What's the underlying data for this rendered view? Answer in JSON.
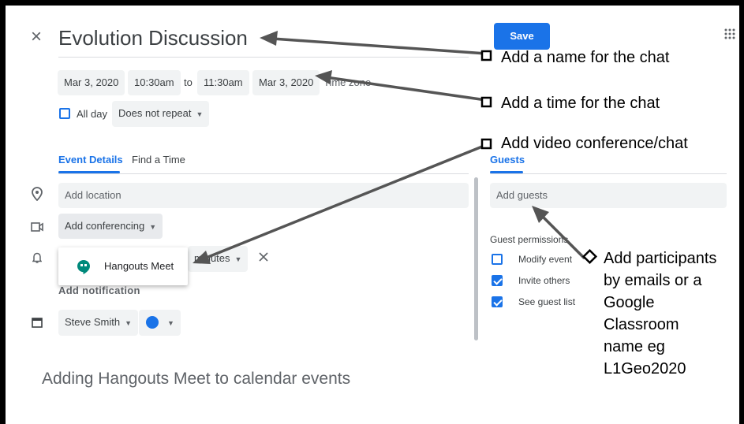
{
  "event": {
    "close_glyph": "×",
    "title": "Evolution Discussion",
    "save_label": "Save",
    "start_date": "Mar 3, 2020",
    "start_time": "10:30am",
    "to_label": "to",
    "end_time": "11:30am",
    "end_date": "Mar 3, 2020",
    "time_zone_label": "Time zone",
    "all_day_label": "All day",
    "repeat_label": "Does not repeat"
  },
  "tabs": {
    "details": "Event Details",
    "find_time": "Find a Time",
    "guests": "Guests"
  },
  "details": {
    "location_placeholder": "Add location",
    "conferencing_label": "Add conferencing",
    "hangouts_label": "Hangouts Meet",
    "notif_unit": "minutes",
    "add_notification": "Add notification",
    "calendar_owner": "Steve Smith",
    "calendar_color": "#1a73e8"
  },
  "guests": {
    "add_placeholder": "Add guests",
    "permissions_heading": "Guest permissions",
    "perm_modify": "Modify event",
    "perm_invite": "Invite others",
    "perm_see": "See guest list"
  },
  "annotations": {
    "name": "Add a name for the chat",
    "time": "Add a time for the chat",
    "video": "Add video conference/chat",
    "participants_1": "Add participants",
    "participants_2": "by emails or a",
    "participants_3": "Google",
    "participants_4": "Classroom",
    "participants_5": "name eg",
    "participants_6": "L1Geo2020"
  },
  "caption": "Adding Hangouts Meet to calendar events",
  "colors": {
    "accent": "#1a73e8",
    "hangouts": "#00897b"
  }
}
